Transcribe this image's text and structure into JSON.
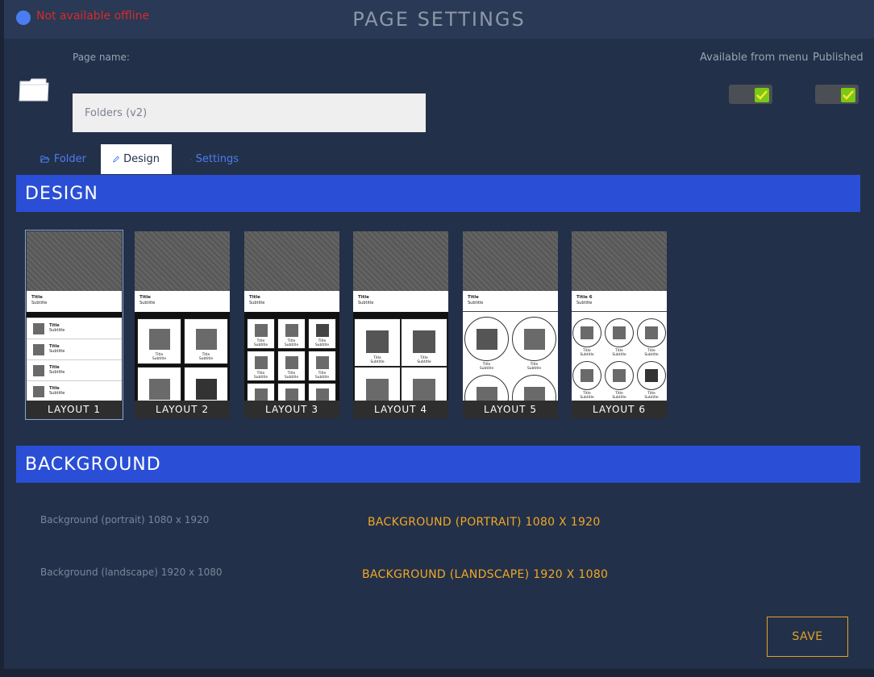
{
  "status": {
    "text": "Not available offline"
  },
  "header": {
    "title": "PAGE SETTINGS"
  },
  "form": {
    "page_name_label": "Page name:",
    "page_name_value": "Folders (v2)",
    "available_from_menu_label": "Available from menu",
    "available_from_menu_checked": true,
    "published_label": "Published",
    "published_checked": true
  },
  "tabs": [
    {
      "label": "Folder",
      "icon": "folder-open-icon",
      "active": false
    },
    {
      "label": "Design",
      "icon": "pencil-icon",
      "active": true
    },
    {
      "label": "Settings",
      "icon": "cogs-icon",
      "active": false
    }
  ],
  "design": {
    "header": "DESIGN",
    "layouts": [
      {
        "label": "LAYOUT 1",
        "selected": true
      },
      {
        "label": "LAYOUT 2",
        "selected": false
      },
      {
        "label": "LAYOUT 3",
        "selected": false
      },
      {
        "label": "LAYOUT 4",
        "selected": false
      },
      {
        "label": "LAYOUT 5",
        "selected": false
      },
      {
        "label": "LAYOUT 6",
        "selected": false
      }
    ],
    "preview_title": "Title",
    "preview_title_6": "Title 6",
    "preview_subtitle": "Subtitle"
  },
  "background": {
    "header": "BACKGROUND",
    "portrait_label": "Background (portrait) 1080 x 1920",
    "portrait_button": "Background (portrait) 1080 x 1920",
    "landscape_label": "Background (landscape) 1920 x 1080",
    "landscape_button": "Background (landscape) 1920 x 1080"
  },
  "actions": {
    "save": "SAVE"
  },
  "colors": {
    "accent": "#2a4fd6",
    "toggle_on": "#7bc815",
    "warning": "#f0a826",
    "error": "#d62b2b"
  }
}
